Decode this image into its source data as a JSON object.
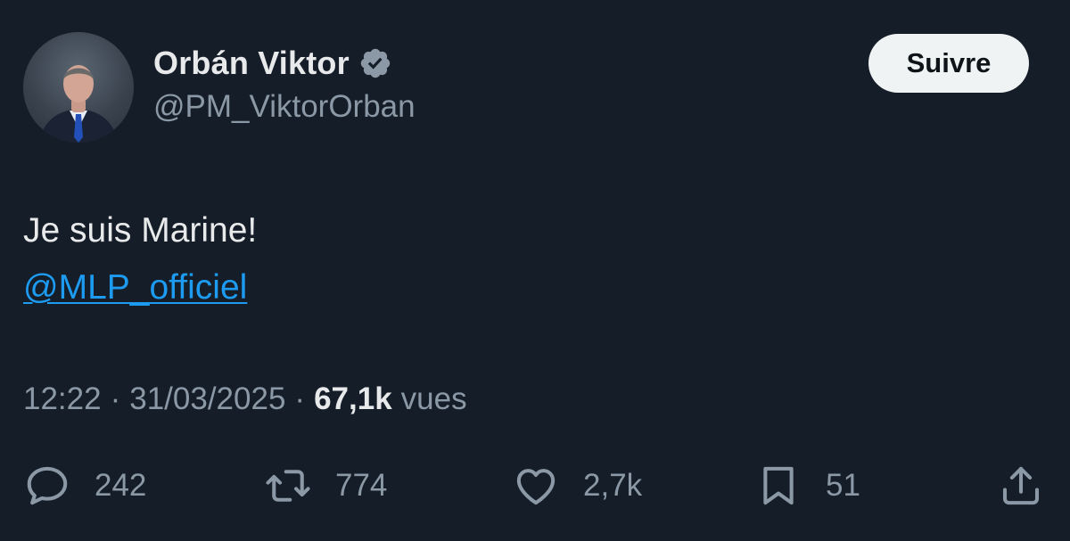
{
  "author": {
    "display_name": "Orbán Viktor",
    "handle": "@PM_ViktorOrban",
    "verified": true
  },
  "follow_button": {
    "label": "Suivre"
  },
  "tweet": {
    "text": "Je suis Marine!",
    "mention": "@MLP_officiel"
  },
  "meta": {
    "time": "12:22",
    "separator": "·",
    "date": "31/03/2025",
    "views_count": "67,1k",
    "views_label": "vues"
  },
  "actions": {
    "replies": "242",
    "retweets": "774",
    "likes": "2,7k",
    "bookmarks": "51"
  },
  "colors": {
    "background": "#151d28",
    "text_primary": "#e7e9ea",
    "text_secondary": "#8b98a5",
    "link": "#1d9bf0",
    "button_bg": "#eff3f4"
  }
}
